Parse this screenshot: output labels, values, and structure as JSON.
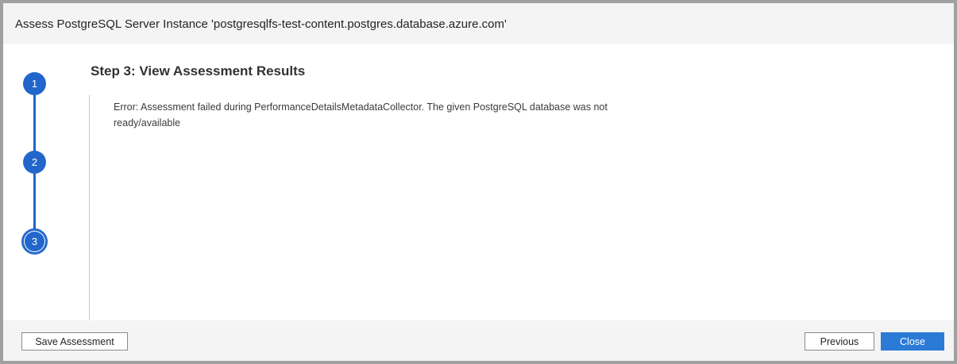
{
  "dialog": {
    "title": "Assess PostgreSQL Server Instance 'postgresqlfs-test-content.postgres.database.azure.com'"
  },
  "stepper": {
    "steps": [
      {
        "label": "1"
      },
      {
        "label": "2"
      },
      {
        "label": "3"
      }
    ],
    "current_step": 3,
    "accent_color": "#2266cc"
  },
  "main": {
    "step_title": "Step 3: View Assessment Results",
    "error_message": "Error: Assessment failed during PerformanceDetailsMetadataCollector. The given PostgreSQL database was not ready/available"
  },
  "footer": {
    "save_label": "Save Assessment",
    "previous_label": "Previous",
    "close_label": "Close"
  }
}
